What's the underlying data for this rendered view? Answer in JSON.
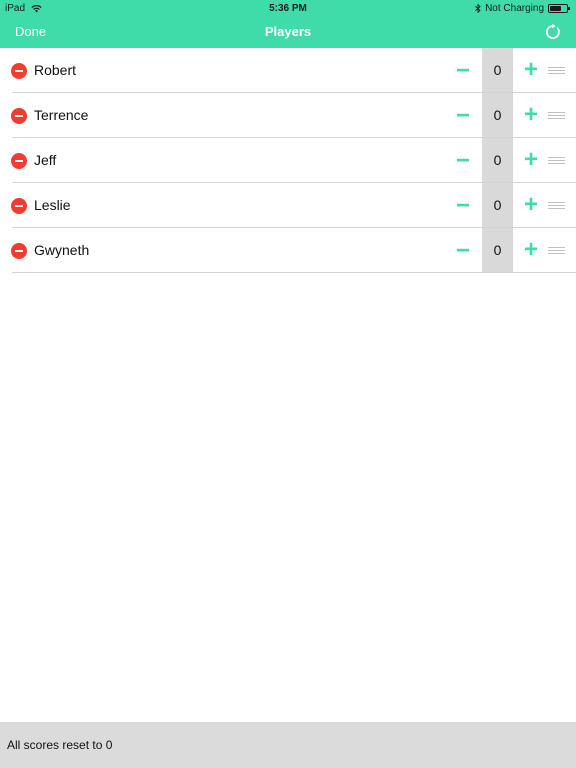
{
  "status_bar": {
    "device": "iPad",
    "time": "5:36 PM",
    "charging": "Not Charging",
    "battery_level": 0.7
  },
  "nav": {
    "done_label": "Done",
    "title": "Players",
    "reset_icon": "refresh-icon"
  },
  "players": [
    {
      "name": "Robert",
      "score": "0"
    },
    {
      "name": "Terrence",
      "score": "0"
    },
    {
      "name": "Jeff",
      "score": "0"
    },
    {
      "name": "Leslie",
      "score": "0"
    },
    {
      "name": "Gwyneth",
      "score": "0"
    }
  ],
  "controls": {
    "minus_label": "−",
    "plus_label": "+"
  },
  "toast": {
    "message": "All scores reset to 0"
  },
  "colors": {
    "accent": "#3fdcaa",
    "delete": "#f33b30",
    "score_bg": "#d9d9d9",
    "toast_bg": "#dbdbdb"
  }
}
